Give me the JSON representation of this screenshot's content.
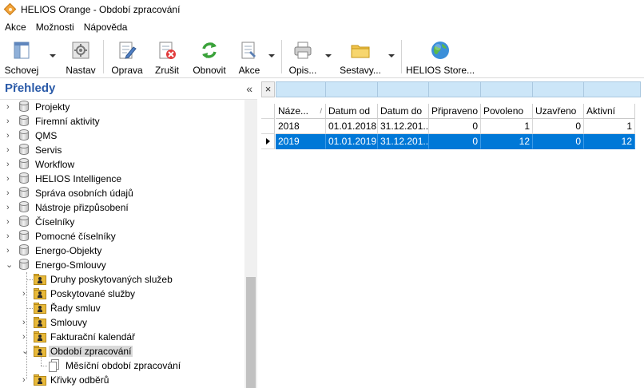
{
  "window": {
    "title": "HELIOS Orange - Období zpracování"
  },
  "menu": [
    "Akce",
    "Možnosti",
    "Nápověda"
  ],
  "toolbar": {
    "schovej": "Schovej",
    "nastav": "Nastav",
    "oprava": "Oprava",
    "zrusit": "Zrušit",
    "obnovit": "Obnovit",
    "akce": "Akce",
    "opis": "Opis...",
    "sestavy": "Sestavy...",
    "store": "HELIOS Store..."
  },
  "sidebar": {
    "title": "Přehledy",
    "collapse": "«",
    "items": [
      "Projekty",
      "Firemní aktivity",
      "QMS",
      "Servis",
      "Workflow",
      "HELIOS Intelligence",
      "Správa osobních údajů",
      "Nástroje přizpůsobení",
      "Číselníky",
      "Pomocné číselníky",
      "Energo-Objekty",
      "Energo-Smlouvy"
    ],
    "children": [
      "Druhy poskytovaných služeb",
      "Poskytované služby",
      "Řady smluv",
      "Smlouvy",
      "Fakturační kalendář",
      "Období zpracování",
      "Měsíční období zpracování",
      "Křivky odběrů"
    ]
  },
  "grid": {
    "filter_close": "×",
    "columns": [
      "Náze...",
      "Datum od",
      "Datum do",
      "Připraveno",
      "Povoleno",
      "Uzavřeno",
      "Aktivní"
    ],
    "sort_indicator": "/",
    "rows": [
      {
        "nazev": "2018",
        "datum_od": "01.01.2018",
        "datum_do": "31.12.201...",
        "pripraveno": "0",
        "povoleno": "1",
        "uzavreno": "0",
        "aktivni": "1"
      },
      {
        "nazev": "2019",
        "datum_od": "01.01.2019",
        "datum_do": "31.12.201...",
        "pripraveno": "0",
        "povoleno": "12",
        "uzavreno": "0",
        "aktivni": "12"
      }
    ]
  }
}
